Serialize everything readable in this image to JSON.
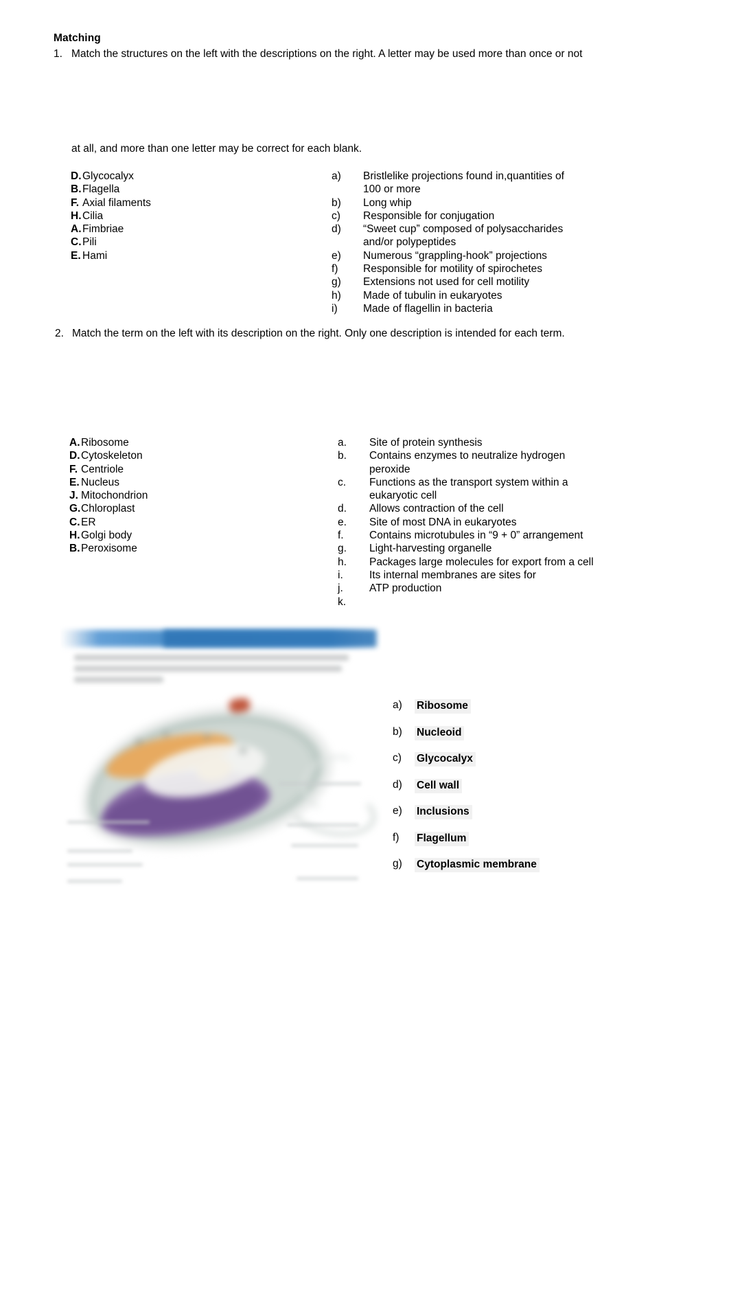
{
  "document": {
    "title": "Matching"
  },
  "questions": [
    {
      "number": "1.",
      "prompt_line1": "Match the structures on the left with the descriptions on the right.  A letter may be used more than once or not",
      "prompt_line2": "at all, and more than one letter may be correct for each blank.",
      "terms": [
        {
          "letter": "D.",
          "name": "Glycocalyx"
        },
        {
          "letter": "B.",
          "name": "Flagella"
        },
        {
          "letter": "F.",
          "name": "Axial filaments"
        },
        {
          "letter": "H.",
          "name": "Cilia"
        },
        {
          "letter": "A.",
          "name": "Fimbriae"
        },
        {
          "letter": "C.",
          "name": "Pili"
        },
        {
          "letter": "E.",
          "name": "Hami"
        }
      ],
      "descriptions": [
        {
          "marker": "a)",
          "text": "Bristlelike projections found in,quantities of",
          "cont": "100 or more"
        },
        {
          "marker": "b)",
          "text": "Long whip",
          "cont": ""
        },
        {
          "marker": "c)",
          "text": "Responsible for conjugation",
          "cont": ""
        },
        {
          "marker": "d)",
          "text": "“Sweet cup” composed of polysaccharides",
          "cont": "and/or polypeptides"
        },
        {
          "marker": "e)",
          "text": "Numerous “grappling-hook” projections",
          "cont": ""
        },
        {
          "marker": "f)",
          "text": "Responsible for motility of spirochetes",
          "cont": ""
        },
        {
          "marker": "g)",
          "text": "Extensions not used for cell motility",
          "cont": ""
        },
        {
          "marker": "h)",
          "text": "Made of tubulin in eukaryotes",
          "cont": ""
        },
        {
          "marker": "i)",
          "text": "Made of flagellin in bacteria",
          "cont": ""
        }
      ]
    },
    {
      "number": "2.",
      "prompt_line1": "Match the term on the left with its description on the right. Only one description is intended for each term.",
      "prompt_line2": "",
      "terms": [
        {
          "letter": "A.",
          "name": "Ribosome"
        },
        {
          "letter": "D.",
          "name": "Cytoskeleton"
        },
        {
          "letter": "F.",
          "name": "Centriole"
        },
        {
          "letter": "E.",
          "name": "Nucleus"
        },
        {
          "letter": "J.",
          "name": "Mitochondrion"
        },
        {
          "letter": "G.",
          "name": "Chloroplast"
        },
        {
          "letter": "C.",
          "name": "ER"
        },
        {
          "letter": "H.",
          "name": "Golgi body"
        },
        {
          "letter": "B.",
          "name": "Peroxisome"
        }
      ],
      "descriptions": [
        {
          "marker": "a.",
          "text": "Site of protein synthesis",
          "cont": ""
        },
        {
          "marker": "b.",
          "text": "Contains enzymes to neutralize hydrogen",
          "cont": "peroxide"
        },
        {
          "marker": "c.",
          "text": "Functions as the transport system within a",
          "cont": "eukaryotic cell"
        },
        {
          "marker": "d.",
          "text": "Allows contraction of the cell",
          "cont": ""
        },
        {
          "marker": "e.",
          "text": "Site of most DNA in eukaryotes",
          "cont": ""
        },
        {
          "marker": "f.",
          "text": "Contains microtubules in “9 + 0” arrangement",
          "cont": ""
        },
        {
          "marker": "g.",
          "text": "Light-harvesting organelle",
          "cont": ""
        },
        {
          "marker": "h.",
          "text": "Packages large molecules for export from a cell",
          "cont": ""
        },
        {
          "marker": "i.",
          "text": "Its internal membranes are sites for",
          "cont": ""
        },
        {
          "marker": "j.",
          "text": "ATP production",
          "cont": ""
        },
        {
          "marker": "k.",
          "text": "",
          "cont": ""
        }
      ]
    }
  ],
  "figure_labels": [
    {
      "marker": "a)",
      "text": "Ribosome"
    },
    {
      "marker": "b)",
      "text": "Nucleoid"
    },
    {
      "marker": "c)",
      "text": "Glycocalyx"
    },
    {
      "marker": "d)",
      "text": "Cell wall"
    },
    {
      "marker": "e)",
      "text": "Inclusions"
    },
    {
      "marker": "f)",
      "text": "Flagellum"
    },
    {
      "marker": "g)",
      "text": "Cytoplasmic membrane"
    }
  ],
  "figure": {
    "name": "blurred-prokaryotic-cell-diagram",
    "banner_color": "#2e75b6",
    "highlight_color": "#5b9bd5"
  }
}
